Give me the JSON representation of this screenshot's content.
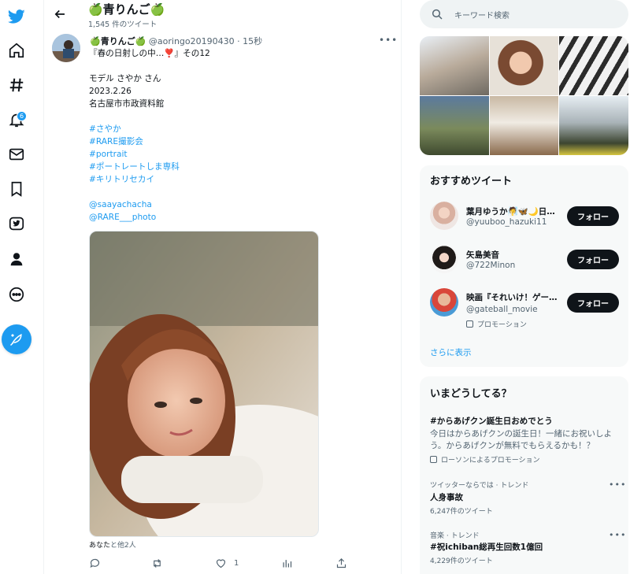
{
  "header": {
    "title": "🍏青りんご🍏",
    "tweet_count": "1,545 件のツイート"
  },
  "nav": {
    "notification_count": "6"
  },
  "tweet": {
    "name": "🍏青りんご🍏",
    "handle": "@aoringo20190430",
    "time": "· 15秒",
    "lines": {
      "l1": "『春の日射しの中…❣️』その12",
      "l2": "モデル さやか さん",
      "l3": "2023.2.26",
      "l4": "名古屋市市政資料館",
      "t1": "#さやか",
      "t2": "#RARE撮影会",
      "t3": "#portrait",
      "t4": "#ポートレートしま専科",
      "t5": "#キリトリセカイ",
      "m1": "@saayachacha",
      "m2": "@RARE___photo"
    },
    "likers_you": "あなた",
    "likers_rest": "と他2人",
    "like_count": "1"
  },
  "search": {
    "placeholder": "キーワード検索"
  },
  "recommended": {
    "title": "おすすめツイート",
    "follow_label": "フォロー",
    "show_more": "さらに表示",
    "users": [
      {
        "name": "葉月ゆうか🧖🦋🌙日…",
        "handle": "@yuuboo_hazuki11"
      },
      {
        "name": "矢島美音",
        "handle": "@722Minon"
      },
      {
        "name": "映画『それいけ！ゲー…",
        "handle": "@gateball_movie",
        "promo": "プロモーション"
      }
    ]
  },
  "trends": {
    "title": "いまどうしてる？",
    "items": [
      {
        "title": "#からあげクン誕生日おめでとう",
        "desc": "今日はからあげクンの誕生日！一緒にお祝いしよう。からあげクンが無料でもらえるかも！？",
        "promo": "ローソンによるプロモーション"
      },
      {
        "meta": "ツイッターならでは · トレンド",
        "title": "人身事故",
        "count": "6,247件のツイート"
      },
      {
        "meta": "音楽 · トレンド",
        "title": "#祝ichiban総再生回数1億回",
        "count": "4,229件のツイート"
      }
    ]
  },
  "colors": {
    "accent": "#1d9bf0",
    "text": "#0f1419",
    "muted": "#536471",
    "card_bg": "#f7f9f9"
  }
}
